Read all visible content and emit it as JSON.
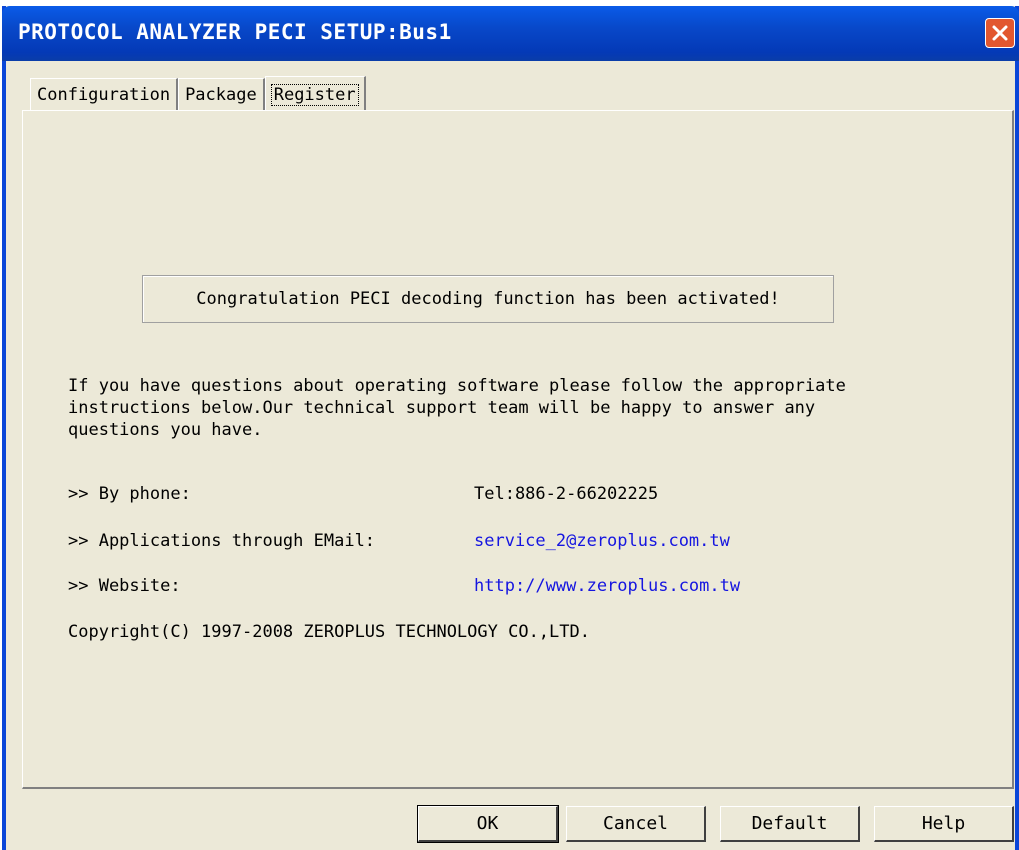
{
  "window": {
    "title": "PROTOCOL ANALYZER PECI SETUP:Bus1"
  },
  "tabs": [
    {
      "label": "Configuration",
      "active": false
    },
    {
      "label": "Package",
      "active": false
    },
    {
      "label": "Register",
      "active": true
    }
  ],
  "register": {
    "banner": "Congratulation PECI decoding function has been activated!",
    "intro": "If you have questions about operating software please follow the appropriate\ninstructions below.Our technical support team will be happy to answer any\nquestions you have.",
    "phone_label": ">> By phone:",
    "phone_value": "Tel:886-2-66202225",
    "email_label": ">> Applications through EMail:",
    "email_value": "service_2@zeroplus.com.tw",
    "website_label": ">> Website:",
    "website_value": "http://www.zeroplus.com.tw",
    "copyright": "Copyright(C) 1997-2008 ZEROPLUS TECHNOLOGY CO.,LTD."
  },
  "buttons": {
    "ok": "OK",
    "cancel": "Cancel",
    "default": "Default",
    "help": "Help"
  },
  "colors": {
    "title_bar": "#0848c9",
    "link": "#1515e0",
    "close_button": "#e2572f",
    "dialog_bg": "#ece9d8"
  },
  "icons": {
    "close": "close-icon"
  }
}
